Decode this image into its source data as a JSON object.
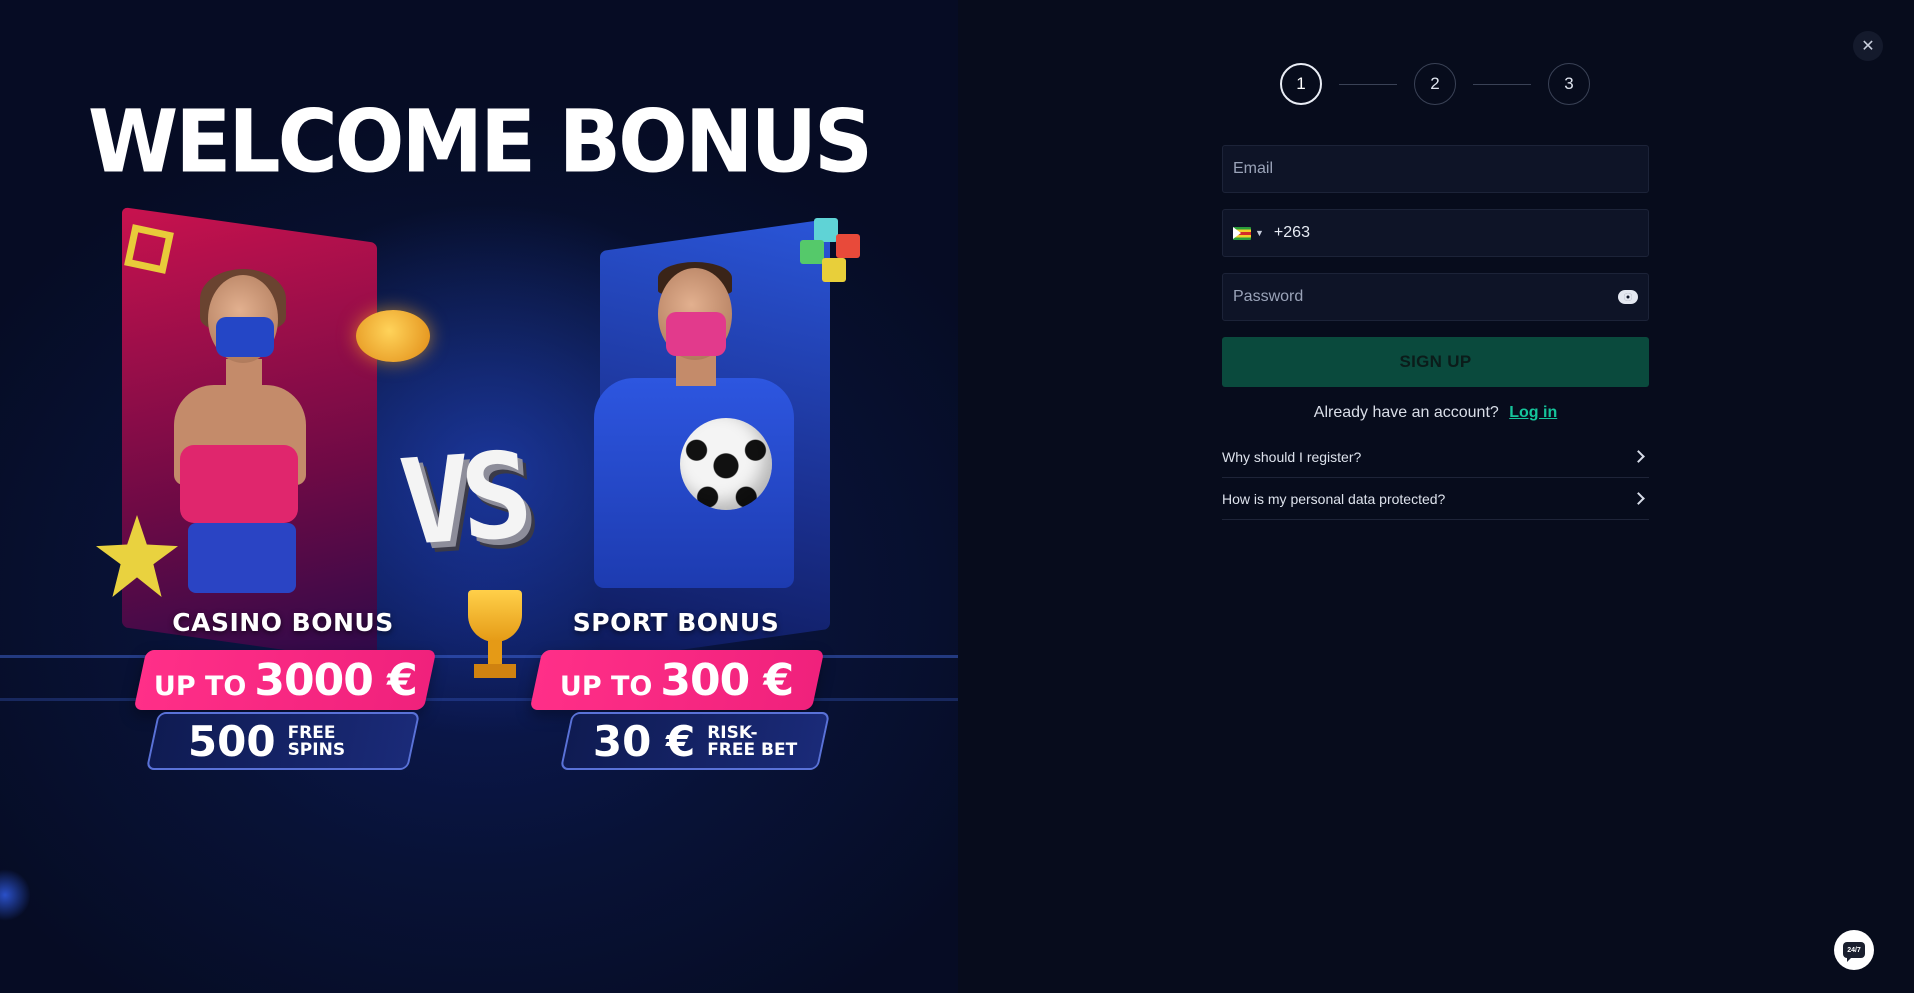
{
  "promo": {
    "title": "WELCOME BONUS",
    "casino": {
      "label": "CASINO BONUS",
      "up_to": "UP TO",
      "amount": "3000 €",
      "spins_count": "500",
      "spins_label": "FREE SPINS"
    },
    "sport": {
      "label": "SPORT BONUS",
      "up_to": "UP TO",
      "amount": "300 €",
      "bet_amount": "30 €",
      "bet_label": "RISK-FREE BET"
    },
    "vs_text": "VS"
  },
  "stepper": {
    "steps": [
      "1",
      "2",
      "3"
    ],
    "active_step": "1"
  },
  "form": {
    "email_placeholder": "Email",
    "phone_code": "+263",
    "country_flag": "zimbabwe-flag",
    "password_placeholder": "Password",
    "signup_label": "SIGN UP",
    "already_text": "Already have an account?",
    "login_label": "Log in"
  },
  "faq": {
    "items": [
      "Why should I register?",
      "How is my personal data protected?"
    ]
  },
  "chat": {
    "label": "24/7"
  },
  "icons": {
    "close": "close-icon",
    "eye": "eye-icon",
    "chevron": "chevron-right-icon",
    "chat": "chat-support-icon"
  },
  "colors": {
    "accent_green": "#15c59b",
    "signup_bg": "#0a4a3d",
    "pink": "#f0217c",
    "background": "#070c1c"
  }
}
